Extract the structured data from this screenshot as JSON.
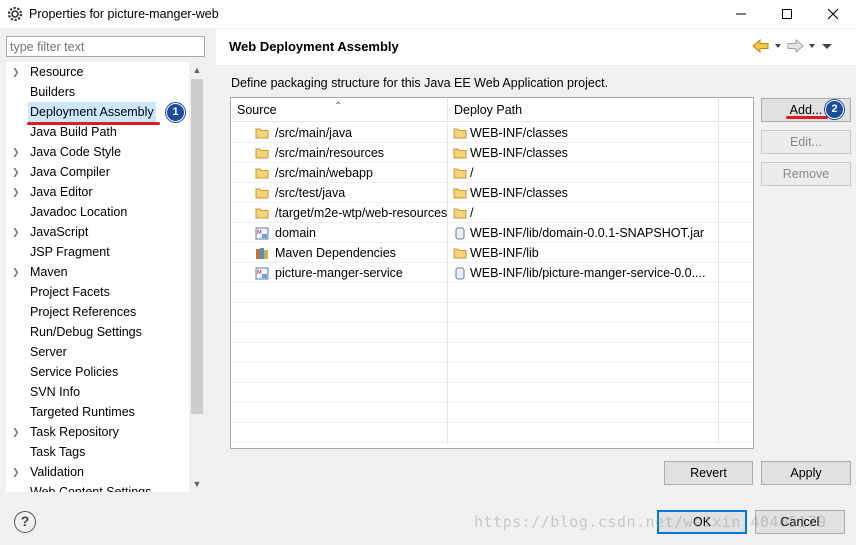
{
  "window": {
    "title": "Properties for picture-manger-web",
    "icon": "gear-icon"
  },
  "filter": {
    "placeholder": "type filter text",
    "value": ""
  },
  "tree": {
    "items": [
      {
        "label": "Resource",
        "expandable": true
      },
      {
        "label": "Builders",
        "expandable": false
      },
      {
        "label": "Deployment Assembly",
        "expandable": false,
        "selected": true
      },
      {
        "label": "Java Build Path",
        "expandable": false
      },
      {
        "label": "Java Code Style",
        "expandable": true
      },
      {
        "label": "Java Compiler",
        "expandable": true
      },
      {
        "label": "Java Editor",
        "expandable": true
      },
      {
        "label": "Javadoc Location",
        "expandable": false
      },
      {
        "label": "JavaScript",
        "expandable": true
      },
      {
        "label": "JSP Fragment",
        "expandable": false
      },
      {
        "label": "Maven",
        "expandable": true
      },
      {
        "label": "Project Facets",
        "expandable": false
      },
      {
        "label": "Project References",
        "expandable": false
      },
      {
        "label": "Run/Debug Settings",
        "expandable": false
      },
      {
        "label": "Server",
        "expandable": false
      },
      {
        "label": "Service Policies",
        "expandable": false
      },
      {
        "label": "SVN Info",
        "expandable": false
      },
      {
        "label": "Targeted Runtimes",
        "expandable": false
      },
      {
        "label": "Task Repository",
        "expandable": true
      },
      {
        "label": "Task Tags",
        "expandable": false
      },
      {
        "label": "Validation",
        "expandable": true
      },
      {
        "label": "Web Content Settings",
        "expandable": false
      }
    ]
  },
  "annotations": {
    "badge1": "1",
    "badge2": "2"
  },
  "page": {
    "title": "Web Deployment Assembly",
    "description": "Define packaging structure for this Java EE Web Application project."
  },
  "table": {
    "headers": {
      "source": "Source",
      "deploy": "Deploy Path"
    },
    "rows": [
      {
        "source": "/src/main/java",
        "source_icon": "folder-icon",
        "deploy": "WEB-INF/classes",
        "deploy_icon": "folder-icon"
      },
      {
        "source": "/src/main/resources",
        "source_icon": "folder-icon",
        "deploy": "WEB-INF/classes",
        "deploy_icon": "folder-icon"
      },
      {
        "source": "/src/main/webapp",
        "source_icon": "folder-icon",
        "deploy": "/",
        "deploy_icon": "folder-icon"
      },
      {
        "source": "/src/test/java",
        "source_icon": "folder-icon",
        "deploy": "WEB-INF/classes",
        "deploy_icon": "folder-icon"
      },
      {
        "source": "/target/m2e-wtp/web-resources",
        "source_icon": "folder-icon",
        "deploy": "/",
        "deploy_icon": "folder-icon"
      },
      {
        "source": "domain",
        "source_icon": "maven-project-icon",
        "deploy": "WEB-INF/lib/domain-0.0.1-SNAPSHOT.jar",
        "deploy_icon": "jar-icon"
      },
      {
        "source": "Maven Dependencies",
        "source_icon": "library-icon",
        "deploy": "WEB-INF/lib",
        "deploy_icon": "folder-icon"
      },
      {
        "source": "picture-manger-service",
        "source_icon": "maven-project-icon",
        "deploy": "WEB-INF/lib/picture-manger-service-0.0....",
        "deploy_icon": "jar-icon"
      }
    ]
  },
  "buttons": {
    "add": "Add...",
    "edit": "Edit...",
    "remove": "Remove",
    "revert": "Revert",
    "apply": "Apply",
    "ok": "OK",
    "cancel": "Cancel"
  },
  "watermark": "https://blog.csdn.net/weixin_40405179",
  "colors": {
    "selection": "#cce8ff",
    "badge": "#1a4d9c",
    "annotation_underline": "#d81e1e",
    "default_button_border": "#0078d7",
    "folder": "#e8b64c"
  }
}
